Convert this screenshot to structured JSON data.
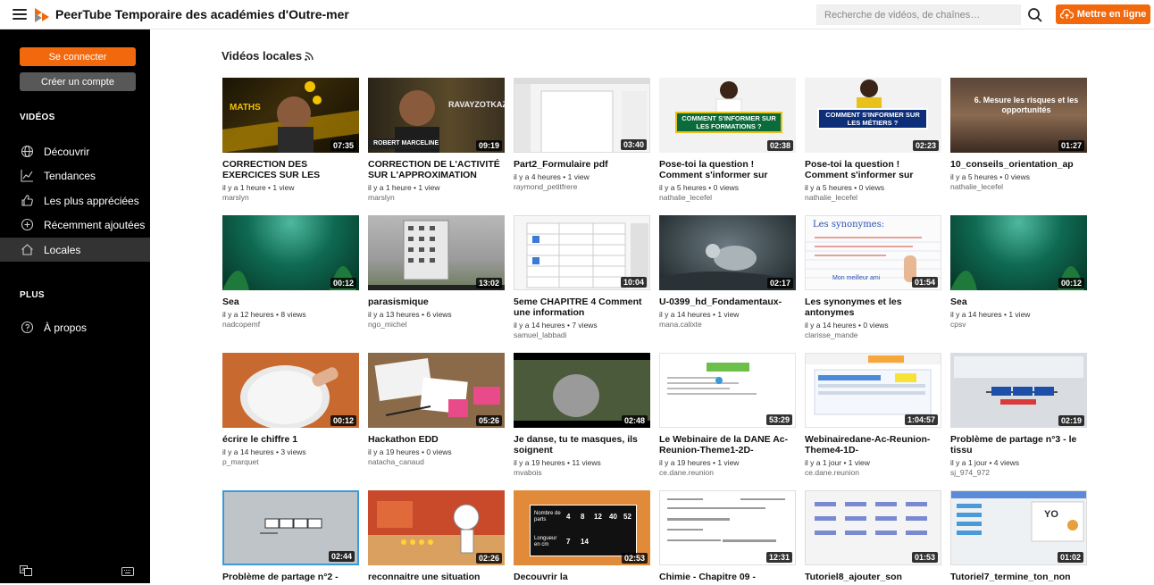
{
  "header": {
    "site_title": "PeerTube Temporaire des académies d'Outre-mer",
    "search_placeholder": "Recherche de vidéos, de chaînes…",
    "upload_label": "Mettre en ligne",
    "accent_color": "#f1680d"
  },
  "sidebar": {
    "login_label": "Se connecter",
    "signup_label": "Créer un compte",
    "videos_section": "VIDÉOS",
    "nav": [
      {
        "label": "Découvrir",
        "icon": "globe-icon"
      },
      {
        "label": "Tendances",
        "icon": "trending-icon"
      },
      {
        "label": "Les plus appréciées",
        "icon": "thumbs-up-icon"
      },
      {
        "label": "Récemment ajoutées",
        "icon": "plus-circle-icon"
      },
      {
        "label": "Locales",
        "icon": "home-icon",
        "active": true
      }
    ],
    "more_section": "PLUS",
    "about_label": "À propos",
    "about_icon": "help-circle-icon",
    "footer_icons": [
      "language-icon",
      "keyboard-icon"
    ]
  },
  "main": {
    "title": "Vidéos locales",
    "videos": [
      {
        "title": "CORRECTION DES EXERCICES SUR LES",
        "meta": "il y a 1 heure • 1 view",
        "author": "marslyn",
        "duration": "07:35"
      },
      {
        "title": "CORRECTION DE L'ACTIVITÉ SUR L'APPROXIMATION",
        "meta": "il y a 1 heure • 1 view",
        "author": "marslyn",
        "duration": "09:19"
      },
      {
        "title": "Part2_Formulaire pdf",
        "meta": "il y a 4 heures • 1 view",
        "author": "raymond_petitfrere",
        "duration": "03:40"
      },
      {
        "title": "Pose-toi la question ! Comment s'informer sur",
        "meta": "il y a 5 heures • 0 views",
        "author": "nathalie_lecefel",
        "duration": "02:38"
      },
      {
        "title": "Pose-toi la question ! Comment s'informer sur",
        "meta": "il y a 5 heures • 0 views",
        "author": "nathalie_lecefel",
        "duration": "02:23"
      },
      {
        "title": "10_conseils_orientation_ap",
        "meta": "il y a 5 heures • 0 views",
        "author": "nathalie_lecefel",
        "duration": "01:27"
      },
      {
        "title": "Sea",
        "meta": "il y a 12 heures • 8 views",
        "author": "nadcopemf",
        "duration": "00:12"
      },
      {
        "title": "parasismique",
        "meta": "il y a 13 heures • 6 views",
        "author": "ngo_michel",
        "duration": "13:02"
      },
      {
        "title": "5eme CHAPITRE 4 Comment une information",
        "meta": "il y a 14 heures • 7 views",
        "author": "samuel_labbadi",
        "duration": "10:04"
      },
      {
        "title": "U-0399_hd_Fondamentaux-",
        "meta": "il y a 14 heures • 1 view",
        "author": "mana.calixte",
        "duration": "02:17"
      },
      {
        "title": "Les synonymes et les antonymes",
        "meta": "il y a 14 heures • 0 views",
        "author": "clarisse_mande",
        "duration": "01:54"
      },
      {
        "title": "Sea",
        "meta": "il y a 14 heures • 1 view",
        "author": "cpsv",
        "duration": "00:12"
      },
      {
        "title": "écrire le chiffre 1",
        "meta": "il y a 14 heures • 3 views",
        "author": "p_marquet",
        "duration": "00:12"
      },
      {
        "title": "Hackathon EDD",
        "meta": "il y a 19 heures • 0 views",
        "author": "natacha_canaud",
        "duration": "05:26"
      },
      {
        "title": "Je danse, tu te masques, ils soignent",
        "meta": "il y a 19 heures • 11 views",
        "author": "mvabois",
        "duration": "02:48"
      },
      {
        "title": "Le Webinaire de la DANE Ac-Reunion-Theme1-2D-",
        "meta": "il y a 19 heures • 1 view",
        "author": "ce.dane.reunion",
        "duration": "53:29"
      },
      {
        "title": "Webinairedane-Ac-Reunion-Theme4-1D-",
        "meta": "il y a 1 jour • 1 view",
        "author": "ce.dane.reunion",
        "duration": "1:04:57"
      },
      {
        "title": "Problème de partage n°3 - le tissu",
        "meta": "il y a 1 jour • 4 views",
        "author": "sj_974_972",
        "duration": "02:19"
      },
      {
        "title": "Problème de partage n°2 -",
        "meta": "",
        "author": "",
        "duration": "02:44"
      },
      {
        "title": "reconnaitre une situation",
        "meta": "",
        "author": "",
        "duration": "02:26"
      },
      {
        "title": "Decouvrir la",
        "meta": "",
        "author": "",
        "duration": "02:53"
      },
      {
        "title": "Chimie - Chapitre 09 -",
        "meta": "",
        "author": "",
        "duration": "12:31"
      },
      {
        "title": "Tutoriel8_ajouter_son",
        "meta": "",
        "author": "",
        "duration": "01:53"
      },
      {
        "title": "Tutoriel7_termine_ton_non",
        "meta": "",
        "author": "",
        "duration": "01:02"
      }
    ],
    "thumb_texts": {
      "t0": "MATHS",
      "t1a": "RAVAYZOTKAZ",
      "t1b": "ROBERT MARCELINE",
      "t3": "COMMENT S'INFORMER SUR LES FORMATIONS ?",
      "t4": "COMMENT S'INFORMER SUR LES MÉTIERS ?",
      "t5": "6. Mesure les risques et les opportunités",
      "t10a": "Les synonymes:",
      "t10b": "Mon meilleur ami",
      "t20a": "Nombre de parts",
      "t20b": "Longueur en cm",
      "t20n": [
        "4",
        "8",
        "12",
        "40",
        "52",
        "7",
        "14"
      ],
      "t23": "YO"
    }
  }
}
